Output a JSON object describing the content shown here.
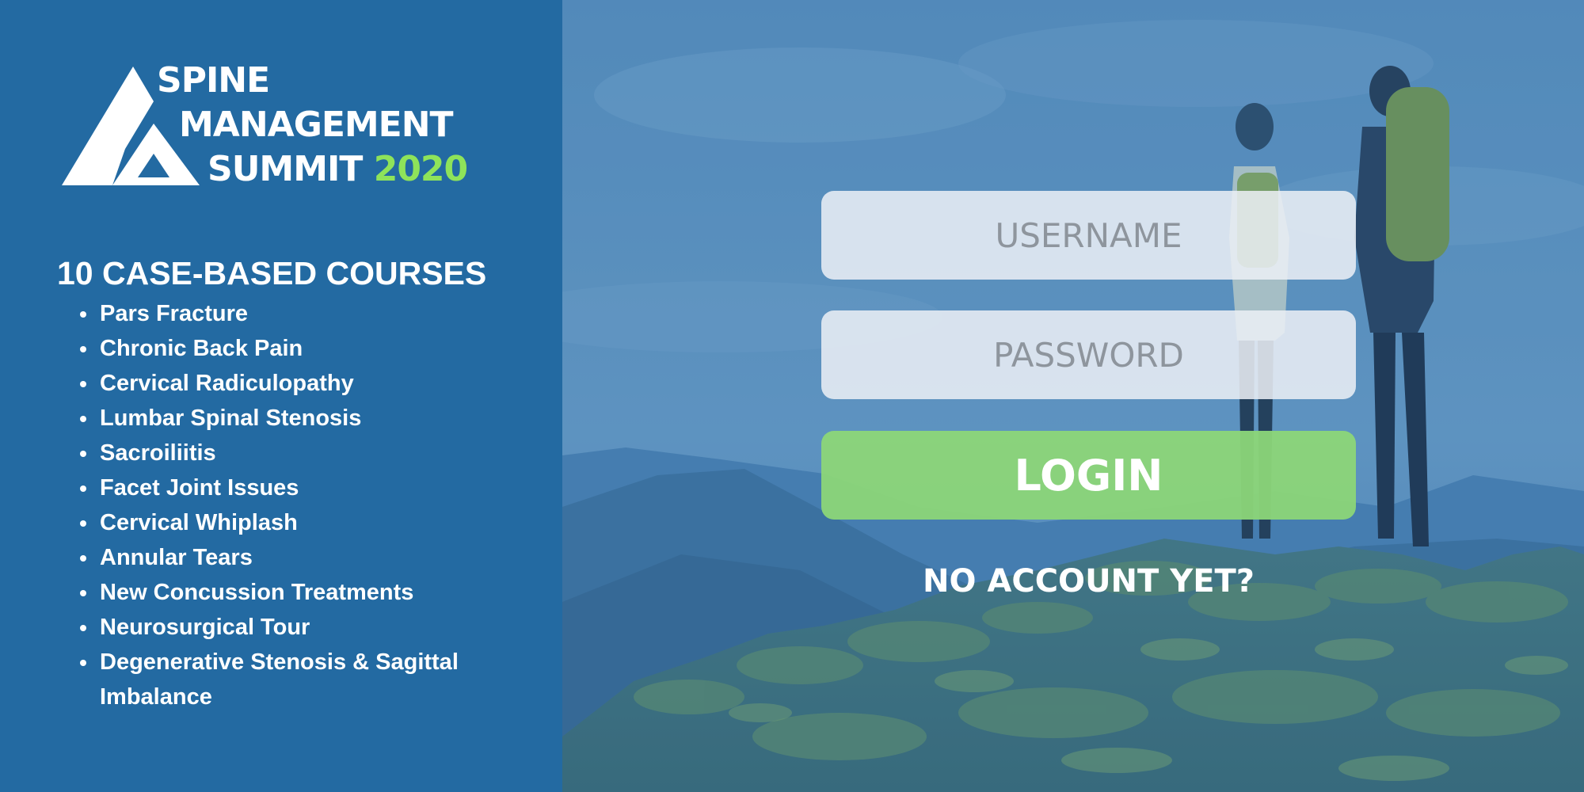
{
  "logo": {
    "line1": "SPINE",
    "line2": "MANAGEMENT",
    "line3": "SUMMIT",
    "year": "2020",
    "year_color": "#8ee35a"
  },
  "courses": {
    "title": "10 CASE-BASED COURSES",
    "items": [
      "Pars Fracture",
      "Chronic Back Pain",
      "Cervical Radiculopathy",
      "Lumbar Spinal Stenosis",
      "Sacroiliitis",
      "Facet Joint Issues",
      "Cervical Whiplash",
      "Annular Tears",
      "New Concussion Treatments",
      "Neurosurgical Tour",
      "Degenerative Stenosis & Sagittal Imbalance"
    ]
  },
  "login": {
    "username_placeholder": "USERNAME",
    "password_placeholder": "PASSWORD",
    "button_label": "LOGIN",
    "no_account_link": "NO ACCOUNT YET?"
  },
  "colors": {
    "panel_blue": "#236aa2",
    "login_green": "#8cd678"
  }
}
